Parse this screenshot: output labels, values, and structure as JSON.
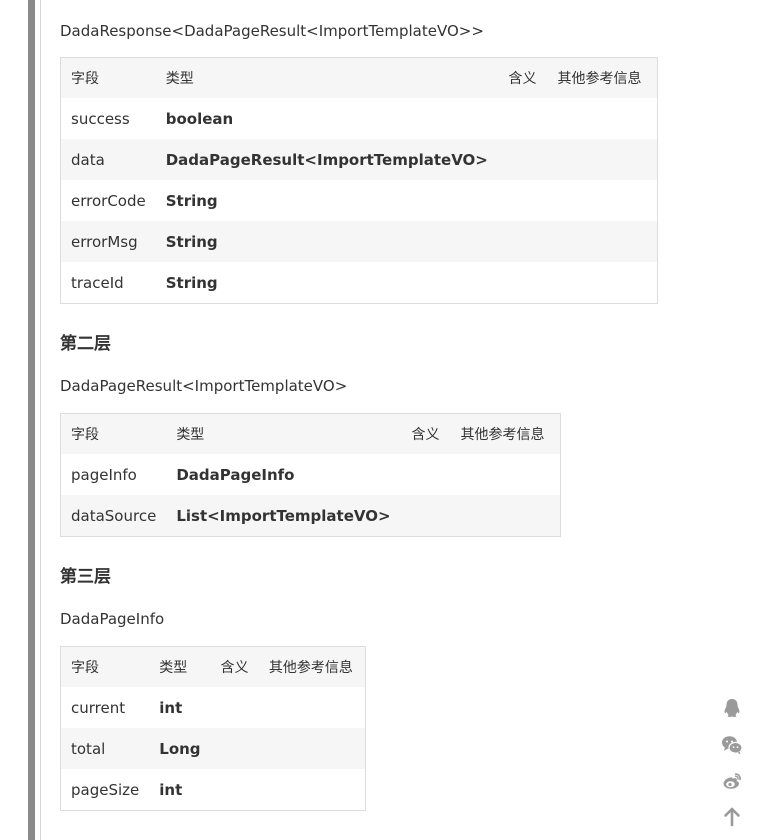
{
  "section1": {
    "type_title": "DadaResponse<DadaPageResult<ImportTemplateVO>>",
    "headers": [
      "字段",
      "类型",
      "含义",
      "其他参考信息"
    ],
    "rows": [
      {
        "field": "success",
        "type": "boolean",
        "link": false
      },
      {
        "field": "data",
        "type": "DadaPageResult<ImportTemplateVO>",
        "link": true
      },
      {
        "field": "errorCode",
        "type": "String",
        "link": false
      },
      {
        "field": "errorMsg",
        "type": "String",
        "link": false
      },
      {
        "field": "traceId",
        "type": "String",
        "link": false
      }
    ]
  },
  "section2": {
    "heading": "第二层",
    "type_title": "DadaPageResult<ImportTemplateVO>",
    "headers": [
      "字段",
      "类型",
      "含义",
      "其他参考信息"
    ],
    "rows": [
      {
        "field": "pageInfo",
        "type": "DadaPageInfo",
        "link": true
      },
      {
        "field": "dataSource",
        "type": "List<ImportTemplateVO>",
        "link": true
      }
    ]
  },
  "section3": {
    "heading": "第三层",
    "type_title": "DadaPageInfo",
    "headers": [
      "字段",
      "类型",
      "含义",
      "其他参考信息"
    ],
    "rows": [
      {
        "field": "current",
        "type": "int",
        "link": false
      },
      {
        "field": "total",
        "type": "Long",
        "link": false
      },
      {
        "field": "pageSize",
        "type": "int",
        "link": false
      }
    ]
  },
  "side_icons": [
    "qq-icon",
    "wechat-icon",
    "weibo-icon",
    "back-to-top-icon"
  ],
  "colors": {
    "link": "#1a9960",
    "text": "#333333",
    "stripe": "#f6f6f6",
    "border": "#dcdcdc",
    "icon": "#9a9a9a"
  }
}
